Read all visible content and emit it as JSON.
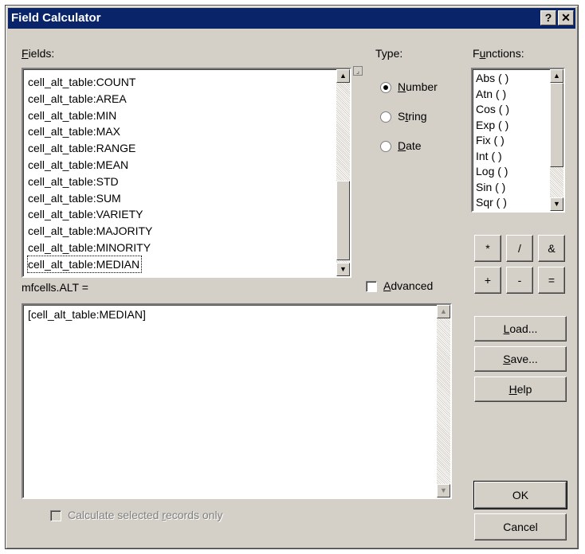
{
  "window": {
    "title": "Field Calculator",
    "help_button": "?",
    "close_button": "✕"
  },
  "fields": {
    "label": "Fields:",
    "items": [
      "cell_alt_table:COUNT",
      "cell_alt_table:AREA",
      "cell_alt_table:MIN",
      "cell_alt_table:MAX",
      "cell_alt_table:RANGE",
      "cell_alt_table:MEAN",
      "cell_alt_table:STD",
      "cell_alt_table:SUM",
      "cell_alt_table:VARIETY",
      "cell_alt_table:MAJORITY",
      "cell_alt_table:MINORITY",
      "cell_alt_table:MEDIAN"
    ],
    "selected": "cell_alt_table:MEDIAN"
  },
  "type": {
    "label": "Type:",
    "options": [
      "Number",
      "String",
      "Date"
    ],
    "selected": "Number"
  },
  "functions": {
    "label": "Functions:",
    "items": [
      "Abs ( )",
      "Atn ( )",
      "Cos ( )",
      "Exp ( )",
      "Fix ( )",
      "Int ( )",
      "Log ( )",
      "Sin ( )",
      "Sqr ( )"
    ]
  },
  "operators": [
    "*",
    "/",
    "&",
    "+",
    "-",
    "="
  ],
  "expression": {
    "label": "mfcells.ALT =",
    "value": "[cell_alt_table:MEDIAN]",
    "advanced_label": "Advanced",
    "advanced_checked": false
  },
  "buttons": {
    "load": "Load...",
    "save": "Save...",
    "help": "Help",
    "ok": "OK",
    "cancel": "Cancel"
  },
  "calculate_selected": {
    "label": "Calculate selected records only",
    "checked": false,
    "enabled": false
  },
  "icons": {
    "scroll_up": "scroll-up-arrow-icon",
    "scroll_down": "scroll-down-arrow-icon",
    "sort_toggle": "sort-toggle-icon"
  }
}
